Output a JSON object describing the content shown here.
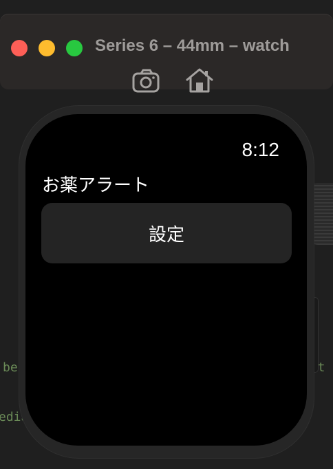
{
  "background_code": {
    "left_top": "be",
    "left_bottom": "edia",
    "right_top": "est"
  },
  "window": {
    "title": "Series 6 – 44mm – watch",
    "toolbar": {
      "screenshot_icon": "camera-icon",
      "home_icon": "home-icon"
    },
    "traffic_lights": {
      "close_color": "#fe5f57",
      "minimize_color": "#febc2e",
      "zoom_color": "#28c840"
    }
  },
  "watch": {
    "status_time": "8:12",
    "app_title": "お薬アラート",
    "settings_button_label": "設定"
  }
}
